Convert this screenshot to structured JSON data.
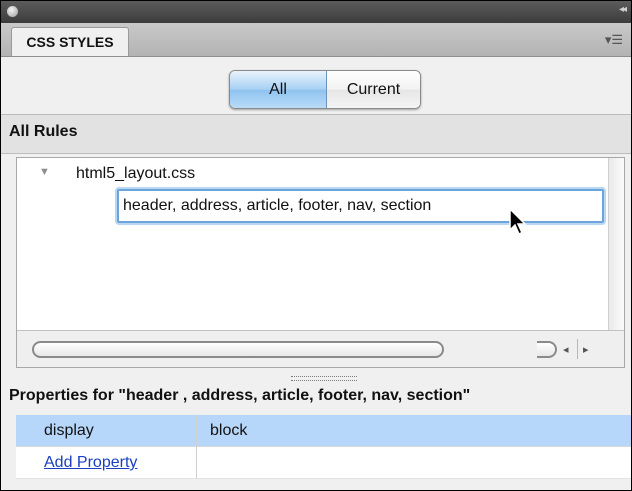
{
  "window": {
    "close_icon": "circle-close-icon",
    "collapse_icon": "double-chevron-icon",
    "collapse_glyph": "◂◂"
  },
  "panel": {
    "tab_label": "CSS STYLES",
    "menu_icon": "panel-menu-icon",
    "menu_glyph": "▾☰"
  },
  "view_toggle": {
    "all_label": "All",
    "current_label": "Current",
    "selected": "All"
  },
  "rules": {
    "section_label": "All Rules",
    "tree_toggle_glyph": "▼",
    "stylesheet": "html5_layout.css",
    "editing_selector": "header, address, article, footer, nav, section"
  },
  "scrollbar": {
    "left_glyph": "◂",
    "right_glyph": "▸"
  },
  "properties": {
    "title": "Properties for \"header , address, article, footer, nav, section\"",
    "rows": [
      {
        "name": "display",
        "value": "block"
      }
    ],
    "add_label": "Add Property"
  },
  "colors": {
    "selection": "#b7d7fa",
    "segment_active": "#8fc3f0",
    "focus_ring": "#6ea4dc",
    "link": "#1a3fc0"
  }
}
